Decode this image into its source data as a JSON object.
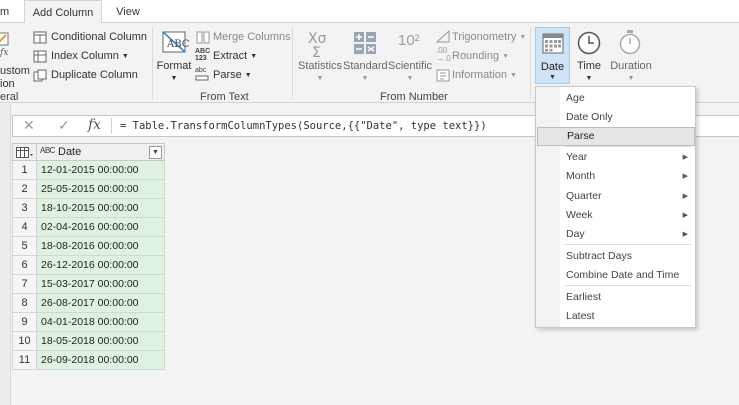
{
  "tabs": [
    {
      "label": "m"
    },
    {
      "label": "Add Column"
    },
    {
      "label": "View"
    }
  ],
  "ribbon": {
    "general": {
      "custom_label_1": "ustom",
      "custom_label_2": "ion",
      "conditional_column": "Conditional Column",
      "index_column": "Index Column",
      "duplicate_column": "Duplicate Column",
      "group_label": "eral"
    },
    "from_text": {
      "format": "Format",
      "merge_columns": "Merge Columns",
      "extract": "Extract",
      "parse": "Parse",
      "group_label": "From Text",
      "extract_icon_text_1": "ABC",
      "extract_icon_text_2": "123",
      "parse_icon_text": "abc"
    },
    "from_number": {
      "statistics": "Statistics",
      "standard": "Standard",
      "scientific": "Scientific",
      "trigonometry": "Trigonometry",
      "rounding": "Rounding",
      "information": "Information",
      "group_label": "From Number",
      "scientific_icon": "10²"
    },
    "from_datetime": {
      "date": "Date",
      "time": "Time",
      "duration": "Duration"
    }
  },
  "formula_bar": {
    "cancel_glyph": "✕",
    "confirm_glyph": "✓",
    "fx_glyph": "fx",
    "formula": "= Table.TransformColumnTypes(Source,{{\"Date\", type text}})"
  },
  "table": {
    "column_header": "Date",
    "type_icon_text": "ABC",
    "filter_glyph": "▼",
    "rows": [
      {
        "num": "1",
        "value": "12-01-2015 00:00:00"
      },
      {
        "num": "2",
        "value": "25-05-2015 00:00:00"
      },
      {
        "num": "3",
        "value": "18-10-2015 00:00:00"
      },
      {
        "num": "4",
        "value": "02-04-2016 00:00:00"
      },
      {
        "num": "5",
        "value": "18-08-2016 00:00:00"
      },
      {
        "num": "6",
        "value": "26-12-2016 00:00:00"
      },
      {
        "num": "7",
        "value": "15-03-2017 00:00:00"
      },
      {
        "num": "8",
        "value": "26-08-2017 00:00:00"
      },
      {
        "num": "9",
        "value": "04-01-2018 00:00:00"
      },
      {
        "num": "10",
        "value": "18-05-2018 00:00:00"
      },
      {
        "num": "11",
        "value": "26-09-2018 00:00:00"
      }
    ]
  },
  "date_menu": {
    "items": [
      {
        "label": "Age"
      },
      {
        "label": "Date Only"
      },
      {
        "label": "Parse"
      },
      {
        "label": "Year"
      },
      {
        "label": "Month"
      },
      {
        "label": "Quarter"
      },
      {
        "label": "Week"
      },
      {
        "label": "Day"
      },
      {
        "label": "Subtract Days"
      },
      {
        "label": "Combine Date and Time"
      },
      {
        "label": "Earliest"
      },
      {
        "label": "Latest"
      }
    ],
    "highlighted": "Parse"
  },
  "colors": {
    "accent_blue": "#2b79c2",
    "data_cell_green": "#dff2e2",
    "date_button_selected": "#cfe4f7"
  }
}
